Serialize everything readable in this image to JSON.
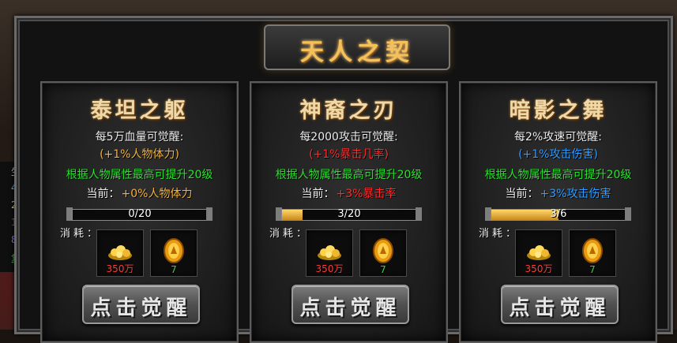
{
  "window": {
    "title": "天人之契"
  },
  "side_strip": {
    "rows": [
      {
        "text": "生",
        "color": "#cfcfcf"
      },
      {
        "text": "4",
        "color": "#2ad5ff"
      },
      {
        "text": "2",
        "color": "#ffd23a"
      },
      {
        "text": "1",
        "color": "#ff4040"
      },
      {
        "text": "8",
        "color": "#a06bff"
      },
      {
        "text": "复",
        "color": "#3bd43b"
      }
    ]
  },
  "panels": [
    {
      "title": "泰坦之躯",
      "requirement": "每5万血量可觉醒:",
      "bonus": "(+1%人物体力)",
      "bonus_color": "#f2b23a",
      "grade": "根据人物属性最高可提升20级",
      "current_label": "当前：",
      "current_value": "+0%人物体力",
      "current_color": "#f2b23a",
      "progress_text": "0/20",
      "progress_value": 0,
      "cost_label": "消耗：",
      "cost_gold": "350万",
      "cost_coin": "7",
      "button_label": "点击觉醒"
    },
    {
      "title": "神裔之刃",
      "requirement": "每2000攻击可觉醒:",
      "bonus": "(+1%暴击几率)",
      "bonus_color": "#ff2a2a",
      "grade": "根据人物属性最高可提升20级",
      "current_label": "当前：",
      "current_value": "+3%暴击率",
      "current_color": "#ff2a2a",
      "progress_text": "3/20",
      "progress_value": 0.15,
      "cost_label": "消耗：",
      "cost_gold": "350万",
      "cost_coin": "7",
      "button_label": "点击觉醒"
    },
    {
      "title": "暗影之舞",
      "requirement": "每2%攻速可觉醒:",
      "bonus": "(+1%攻击伤害)",
      "bonus_color": "#2f9cff",
      "grade": "根据人物属性最高可提升20级",
      "current_label": "当前：",
      "current_value": "+3%攻击伤害",
      "current_color": "#2f9cff",
      "progress_text": "3/6",
      "progress_value": 0.5,
      "cost_label": "消耗：",
      "cost_gold": "350万",
      "cost_coin": "7",
      "button_label": "点击觉醒"
    }
  ],
  "icons": {
    "gold": "gold-pile-icon",
    "coin": "gold-coin-icon"
  }
}
